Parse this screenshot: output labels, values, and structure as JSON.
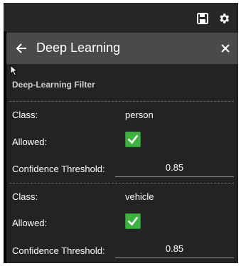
{
  "header": {
    "title": "Deep Learning"
  },
  "icons": {
    "save": "save-icon",
    "settings": "gear-icon",
    "back": "back-arrow-icon",
    "close": "close-icon",
    "check": "checkmark-icon"
  },
  "section": {
    "title": "Deep-Learning Filter"
  },
  "filters": [
    {
      "class_label": "Class:",
      "class_value": "person",
      "allowed_label": "Allowed:",
      "allowed": true,
      "threshold_label": "Confidence Threshold:",
      "threshold_value": "0.85"
    },
    {
      "class_label": "Class:",
      "class_value": "vehicle",
      "allowed_label": "Allowed:",
      "allowed": true,
      "threshold_label": "Confidence Threshold:",
      "threshold_value": "0.85"
    }
  ],
  "colors": {
    "panel_background": "#232323",
    "header_background": "#4a4a4a",
    "checkbox_green": "#3cb341"
  }
}
